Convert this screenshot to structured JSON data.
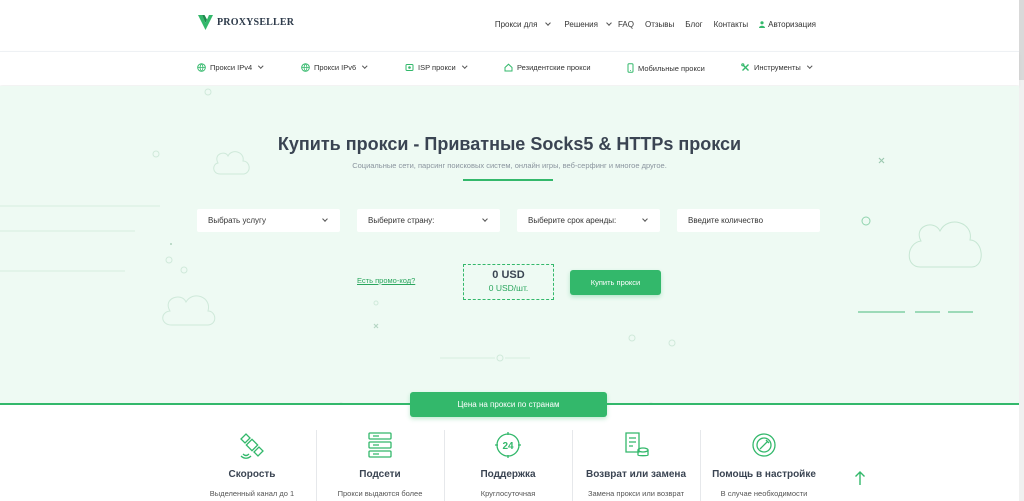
{
  "brand": {
    "name": "PROXYSELLER"
  },
  "topnav": {
    "proxy_for": "Прокси для",
    "solutions": "Решения",
    "faq": "FAQ",
    "reviews": "Отзывы",
    "blog": "Блог",
    "contacts": "Контакты",
    "login": "Авторизация"
  },
  "subnav": [
    {
      "label": "Прокси IPv4",
      "icon": "ipv4-globe-icon"
    },
    {
      "label": "Прокси IPv6",
      "icon": "ipv6-globe-icon"
    },
    {
      "label": "ISP прокси",
      "icon": "isp-icon"
    },
    {
      "label": "Резидентские прокси",
      "icon": "home-icon"
    },
    {
      "label": "Мобильные прокси",
      "icon": "mobile-icon"
    },
    {
      "label": "Инструменты",
      "icon": "tools-icon"
    }
  ],
  "hero": {
    "title": "Купить прокси - Приватные Socks5 & HTTPs прокси",
    "subtitle": "Социальные сети, парсинг поисковых систем, онлайн игры, веб-серфинг и многое другое."
  },
  "form": {
    "service": "Выбрать услугу",
    "country": "Выберите страну:",
    "period": "Выберите срок аренды:",
    "quantity_placeholder": "Введите количество",
    "promo": "Есть промо-код?",
    "price": "0 USD",
    "price_unit": "0 USD/шт.",
    "buy": "Купить прокси"
  },
  "countries_button": "Цена на прокси по странам",
  "features": [
    {
      "title": "Скорость",
      "desc": "Выделенный канал до 1"
    },
    {
      "title": "Подсети",
      "desc": "Прокси выдаются более"
    },
    {
      "title": "Поддержка",
      "desc": "Круглосуточная"
    },
    {
      "title": "Возврат или замена",
      "desc": "Замена прокси или возврат"
    },
    {
      "title": "Помощь в настройке",
      "desc": "В случае необходимости"
    }
  ],
  "colors": {
    "accent": "#33b86b",
    "hero_bg": "#eefaf3",
    "text": "#3a4452"
  }
}
